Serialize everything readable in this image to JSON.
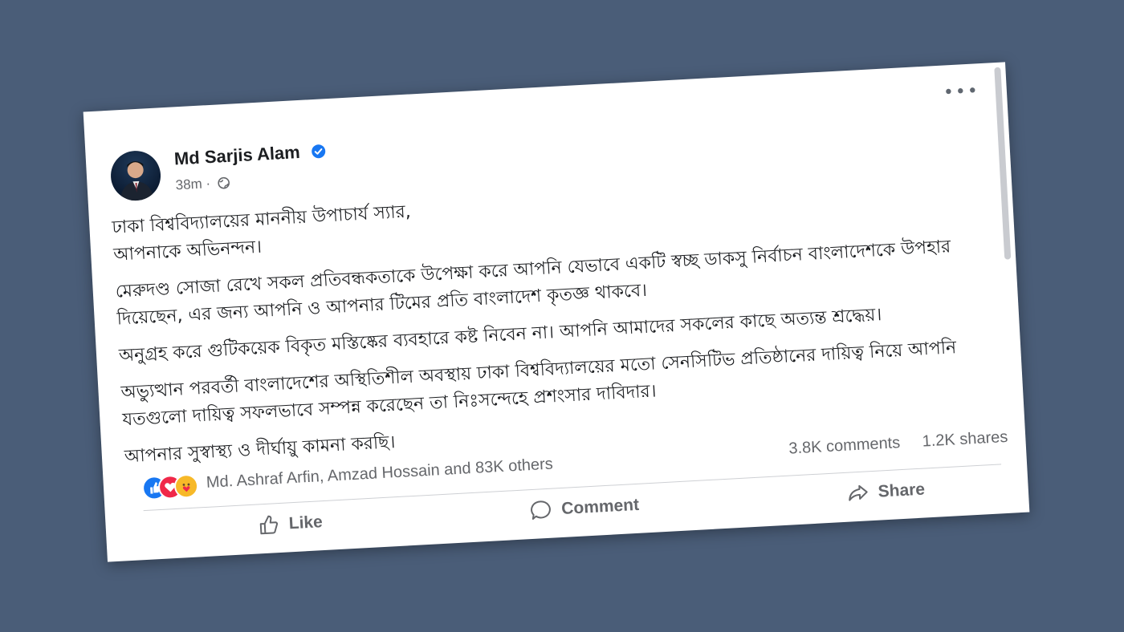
{
  "post": {
    "author": "Md Sarjis Alam",
    "verified": true,
    "time": "38m",
    "privacy_separator": "·",
    "privacy_icon": "globe-icon",
    "body": [
      "ঢাকা বিশ্ববিদ্যালয়ের মাননীয় উপাচার্য স্যার,",
      "আপনাকে অভিনন্দন।",
      "মেরুদণ্ড সোজা রেখে সকল প্রতিবন্ধকতাকে উপেক্ষা করে আপনি যেভাবে একটি স্বচ্ছ ডাকসু নির্বাচন বাংলাদেশকে উপহার দিয়েছেন, এর জন্য আপনি ও আপনার টিমের  প্রতি বাংলাদেশ কৃতজ্ঞ থাকবে।",
      "অনুগ্রহ করে গুটিকয়েক বিকৃত মস্তিষ্কের ব্যবহারে কষ্ট নিবেন না। আপনি আমাদের সকলের কাছে অত্যন্ত শ্রদ্ধেয়।",
      "অভ্যুত্থান পরবর্তী বাংলাদেশের অস্থিতিশীল অবস্থায় ঢাকা বিশ্ববিদ্যালয়ের মতো সেনসিটিভ প্রতিষ্ঠানের দায়িত্ব নিয়ে আপনি যতগুলো দায়িত্ব সফলভাবে সম্পন্ন করেছেন তা নিঃসন্দেহে প্রশংসার দাবিদার।",
      "আপনার সুস্বাস্থ্য ও দীর্ঘায়ু কামনা করছি।"
    ]
  },
  "reactions": {
    "names": "Md. Ashraf Arfin, Amzad Hossain and 83K others",
    "icons": [
      "like-reaction-icon",
      "love-reaction-icon",
      "care-reaction-icon"
    ]
  },
  "counts": {
    "comments": "3.8K comments",
    "shares": "1.2K shares"
  },
  "actions": {
    "like": "Like",
    "comment": "Comment",
    "share": "Share"
  },
  "colors": {
    "background": "#4a5d78",
    "facebook_blue": "#1877f2",
    "love_red": "#f02849",
    "care_yellow": "#f7b928",
    "secondary_text": "#65676b"
  }
}
